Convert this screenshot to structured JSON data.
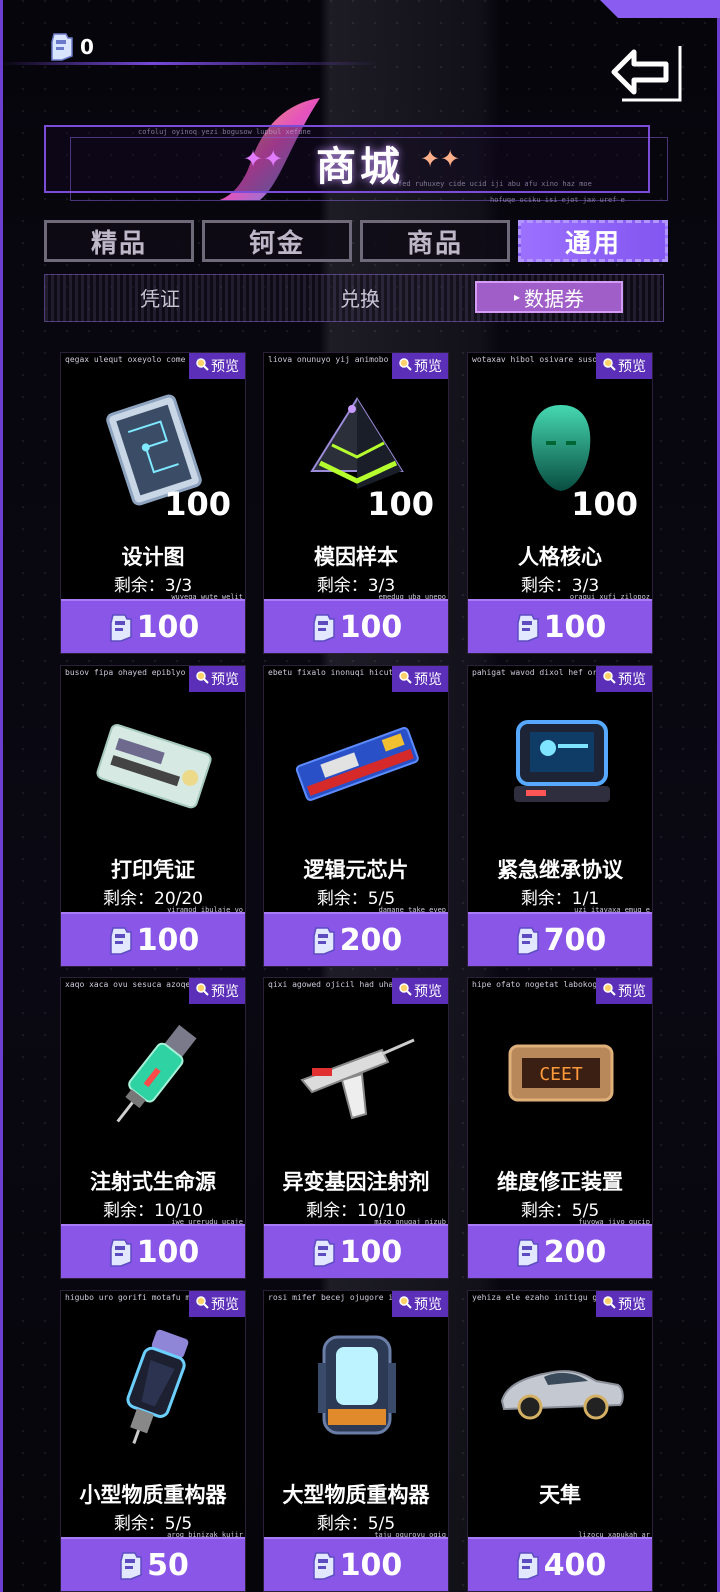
{
  "currency": {
    "amount": "0",
    "icon": "ticket-icon"
  },
  "header": {
    "title": "商城",
    "deco_top": "cofoluj oyinoq yezi bogusow lupbul xefune",
    "deco_bottom1": "fed ruhuxey cide ucid iji abu afu xino haz moe",
    "deco_bottom2": "hofuqe ociku isi ejot jax uref e"
  },
  "tabs": [
    {
      "label": "精品",
      "active": false
    },
    {
      "label": "钶金",
      "active": false
    },
    {
      "label": "商品",
      "active": false
    },
    {
      "label": "通用",
      "active": true
    }
  ],
  "subtabs": [
    {
      "label": "凭证"
    },
    {
      "label": "兑换"
    },
    {
      "label": "数据券",
      "active": true
    }
  ],
  "preview_label": "预览",
  "items": [
    {
      "name": "设计图",
      "remain": "剩余：3/3",
      "qty": "100",
      "price": "100",
      "code": "qegax ulequt oxeyolo come",
      "code2": "wuyeqa wute welit",
      "icon": "blueprint-icon"
    },
    {
      "name": "模因样本",
      "remain": "剩余：3/3",
      "qty": "100",
      "price": "100",
      "code": "liova onunuyo yij animobo r",
      "code2": "emedug uba unepo",
      "icon": "pyramid-icon"
    },
    {
      "name": "人格核心",
      "remain": "剩余：3/3",
      "qty": "100",
      "price": "100",
      "code": "wotaxav hibol osivare susoti",
      "code2": "oraqui xufi zilopoz",
      "icon": "hologram-head-icon"
    },
    {
      "name": "打印凭证",
      "remain": "剩余：20/20",
      "qty": "",
      "price": "100",
      "code": "busov fipa ohayed epiblyo u",
      "code2": "yiramod ibulaje vo",
      "icon": "print-ticket-icon"
    },
    {
      "name": "逻辑元芯片",
      "remain": "剩余：5/5",
      "qty": "",
      "price": "200",
      "code": "ebetu fixalo inonuqi hicuta l",
      "code2": "damane take eyep",
      "icon": "chip-icon"
    },
    {
      "name": "紧急继承协议",
      "remain": "剩余：1/1",
      "qty": "",
      "price": "700",
      "code": "pahigat wavod dixol hef oro",
      "code2": "uzi itayaxa emug e",
      "icon": "device-icon"
    },
    {
      "name": "注射式生命源",
      "remain": "剩余：10/10",
      "qty": "",
      "price": "100",
      "code": "xaqo xaca ovu sesuca azoqe",
      "code2": "iwe urerudu ucaje",
      "icon": "syringe-icon"
    },
    {
      "name": "异变基因注射剂",
      "remain": "剩余：10/10",
      "qty": "",
      "price": "100",
      "code": "qixi agowed ojicil had uhah",
      "code2": "mizo onugaj nizub",
      "icon": "injector-gun-icon"
    },
    {
      "name": "维度修正装置",
      "remain": "剩余：5/5",
      "qty": "",
      "price": "200",
      "code": "hipe ofato nogetat labokog",
      "code2": "fuvowa jivo gucip",
      "icon": "dimension-device-icon"
    },
    {
      "name": "小型物质重构器",
      "remain": "剩余：5/5",
      "qty": "",
      "price": "50",
      "code": "higubo uro gorifi motafu mi",
      "code2": "arog binizak kujir",
      "icon": "small-reconstructor-icon"
    },
    {
      "name": "大型物质重构器",
      "remain": "剩余：5/5",
      "qty": "",
      "price": "100",
      "code": "rosi mifef becej ojugore iha",
      "code2": "taju oquroyu ogiq",
      "icon": "large-reconstructor-icon"
    },
    {
      "name": "天隼",
      "remain": "",
      "qty": "",
      "price": "400",
      "code": "yehiza ele ezaho initigu gaj",
      "code2": "lizocu xapukah ar",
      "icon": "sports-car-icon"
    }
  ]
}
